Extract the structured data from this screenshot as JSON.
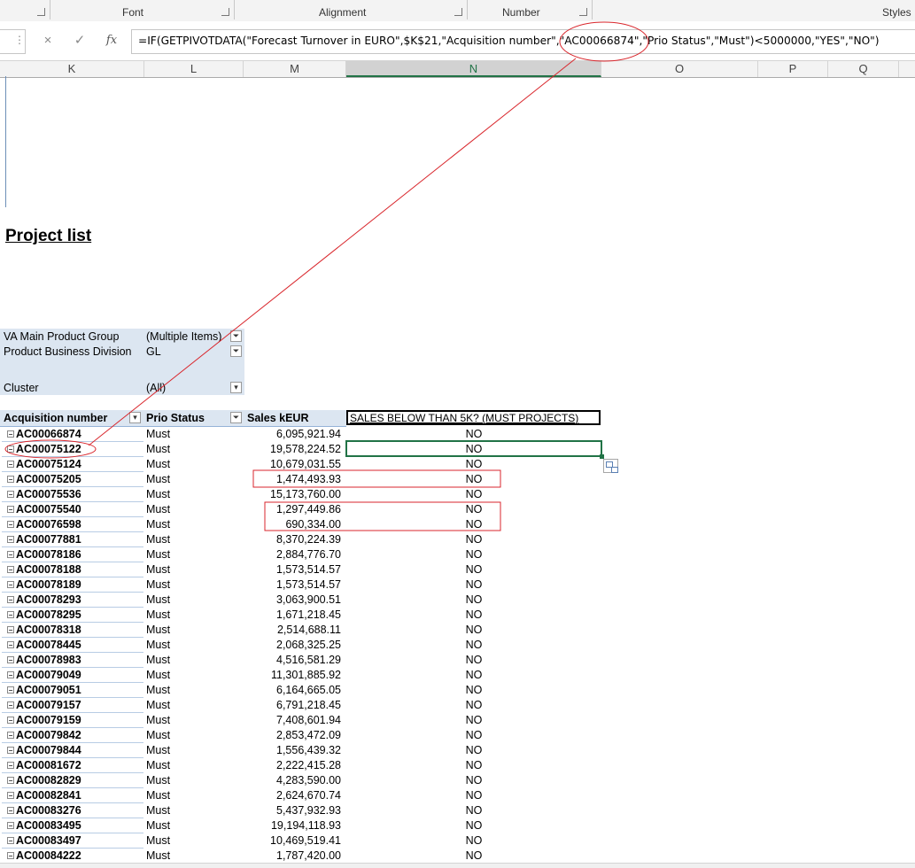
{
  "ribbon": {
    "groups": [
      "Font",
      "Alignment",
      "Number",
      "Styles"
    ]
  },
  "formula_bar": {
    "cancel_icon": "×",
    "enter_icon": "✓",
    "fx_icon": "fx",
    "formula": "=IF(GETPIVOTDATA(\"Forecast Turnover in EURO\",$K$21,\"Acquisition number\",\"AC00066874\",\"Prio Status\",\"Must\")<5000000,\"YES\",\"NO\")"
  },
  "columns": [
    "K",
    "L",
    "M",
    "N",
    "O",
    "P",
    "Q"
  ],
  "selected_column": "N",
  "sheet": {
    "title": "Project list",
    "filters": [
      {
        "label": "VA Main Product Group",
        "value": "(Multiple Items)"
      },
      {
        "label": "Product Business Division",
        "value": "GL"
      },
      {
        "label": "Cluster",
        "value": "(All)"
      }
    ],
    "table_headers": {
      "acquisition": "Acquisition number",
      "prio": "Prio Status",
      "sales": "Sales kEUR",
      "calc": "SALES BELOW THAN 5K? (MUST PROJECTS)"
    },
    "rows": [
      {
        "acq": "AC00066874",
        "prio": "Must",
        "sales": "6,095,921.94",
        "calc": "NO"
      },
      {
        "acq": "AC00075122",
        "prio": "Must",
        "sales": "19,578,224.52",
        "calc": "NO"
      },
      {
        "acq": "AC00075124",
        "prio": "Must",
        "sales": "10,679,031.55",
        "calc": "NO"
      },
      {
        "acq": "AC00075205",
        "prio": "Must",
        "sales": "1,474,493.93",
        "calc": "NO"
      },
      {
        "acq": "AC00075536",
        "prio": "Must",
        "sales": "15,173,760.00",
        "calc": "NO"
      },
      {
        "acq": "AC00075540",
        "prio": "Must",
        "sales": "1,297,449.86",
        "calc": "NO"
      },
      {
        "acq": "AC00076598",
        "prio": "Must",
        "sales": "690,334.00",
        "calc": "NO"
      },
      {
        "acq": "AC00077881",
        "prio": "Must",
        "sales": "8,370,224.39",
        "calc": "NO"
      },
      {
        "acq": "AC00078186",
        "prio": "Must",
        "sales": "2,884,776.70",
        "calc": "NO"
      },
      {
        "acq": "AC00078188",
        "prio": "Must",
        "sales": "1,573,514.57",
        "calc": "NO"
      },
      {
        "acq": "AC00078189",
        "prio": "Must",
        "sales": "1,573,514.57",
        "calc": "NO"
      },
      {
        "acq": "AC00078293",
        "prio": "Must",
        "sales": "3,063,900.51",
        "calc": "NO"
      },
      {
        "acq": "AC00078295",
        "prio": "Must",
        "sales": "1,671,218.45",
        "calc": "NO"
      },
      {
        "acq": "AC00078318",
        "prio": "Must",
        "sales": "2,514,688.11",
        "calc": "NO"
      },
      {
        "acq": "AC00078445",
        "prio": "Must",
        "sales": "2,068,325.25",
        "calc": "NO"
      },
      {
        "acq": "AC00078983",
        "prio": "Must",
        "sales": "4,516,581.29",
        "calc": "NO"
      },
      {
        "acq": "AC00079049",
        "prio": "Must",
        "sales": "11,301,885.92",
        "calc": "NO"
      },
      {
        "acq": "AC00079051",
        "prio": "Must",
        "sales": "6,164,665.05",
        "calc": "NO"
      },
      {
        "acq": "AC00079157",
        "prio": "Must",
        "sales": "6,791,218.45",
        "calc": "NO"
      },
      {
        "acq": "AC00079159",
        "prio": "Must",
        "sales": "7,408,601.94",
        "calc": "NO"
      },
      {
        "acq": "AC00079842",
        "prio": "Must",
        "sales": "2,853,472.09",
        "calc": "NO"
      },
      {
        "acq": "AC00079844",
        "prio": "Must",
        "sales": "1,556,439.32",
        "calc": "NO"
      },
      {
        "acq": "AC00081672",
        "prio": "Must",
        "sales": "2,222,415.28",
        "calc": "NO"
      },
      {
        "acq": "AC00082829",
        "prio": "Must",
        "sales": "4,283,590.00",
        "calc": "NO"
      },
      {
        "acq": "AC00082841",
        "prio": "Must",
        "sales": "2,624,670.74",
        "calc": "NO"
      },
      {
        "acq": "AC00083276",
        "prio": "Must",
        "sales": "5,437,932.93",
        "calc": "NO"
      },
      {
        "acq": "AC00083495",
        "prio": "Must",
        "sales": "19,194,118.93",
        "calc": "NO"
      },
      {
        "acq": "AC00083497",
        "prio": "Must",
        "sales": "10,469,519.41",
        "calc": "NO"
      },
      {
        "acq": "AC00084222",
        "prio": "Must",
        "sales": "1,787,420.00",
        "calc": "NO"
      }
    ]
  },
  "colors": {
    "annotation_red": "#d9262c",
    "selection_green": "#217346",
    "pivot_fill": "#dce6f1"
  }
}
